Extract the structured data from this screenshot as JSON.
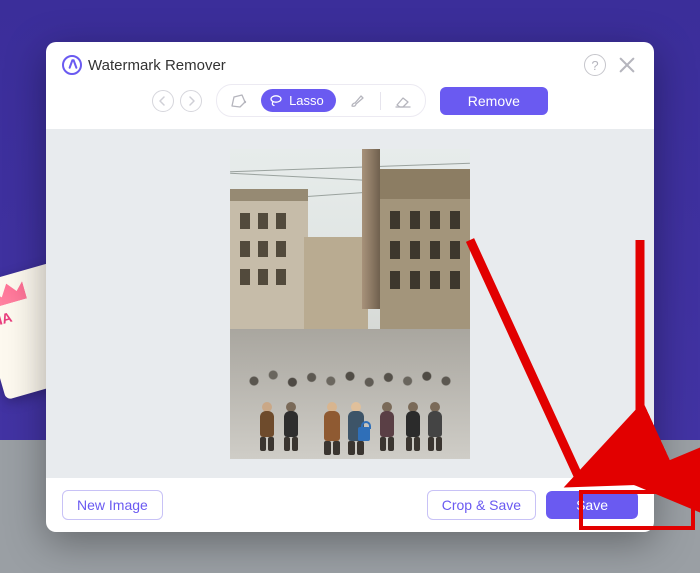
{
  "app": {
    "title": "Watermark Remover"
  },
  "toolbar": {
    "lasso_label": "Lasso",
    "remove_label": "Remove"
  },
  "footer": {
    "new_image_label": "New Image",
    "crop_save_label": "Crop & Save",
    "save_label": "Save"
  },
  "colors": {
    "accent": "#6a5af1",
    "highlight": "#e20000"
  }
}
